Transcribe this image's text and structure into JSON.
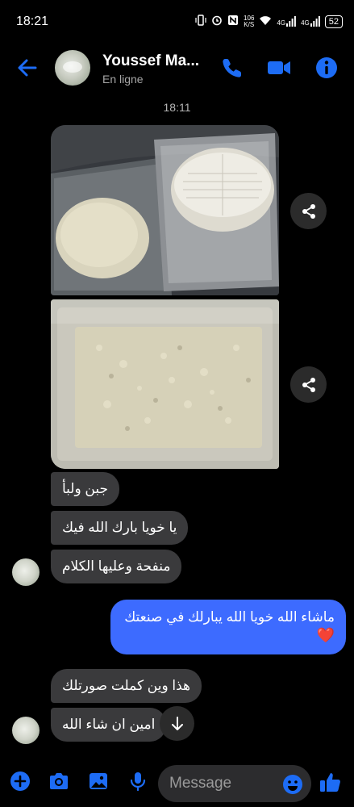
{
  "status_bar": {
    "time": "18:21",
    "net_speed_value": "106",
    "net_speed_unit": "K/S",
    "signal1_label": "4G",
    "signal2_label": "4G",
    "battery": "52"
  },
  "header": {
    "contact_name": "Youssef Ma...",
    "contact_status": "En ligne"
  },
  "conversation": {
    "timestamp": "18:11",
    "received_group_1": [
      "جبن ولبأ",
      "يا خويا بارك الله فيك",
      "منفحة وعليها الكلام"
    ],
    "sent_message": {
      "text": "ماشاء الله خويا الله يبارلك في صنعتك",
      "emoji": "❤️"
    },
    "received_group_2": [
      "هذا وين كملت صورتلك",
      "امين ان شاء الله"
    ]
  },
  "composer": {
    "placeholder": "Message"
  },
  "colors": {
    "accent": "#3d6bff",
    "icon_blue": "#1d6cf5",
    "received_bubble": "#3a3a3c",
    "background": "#000000"
  },
  "icons": [
    "back-arrow-icon",
    "phone-icon",
    "video-camera-icon",
    "info-icon",
    "share-icon",
    "arrow-down-icon",
    "plus-icon",
    "camera-icon",
    "image-icon",
    "microphone-icon",
    "emoji-icon",
    "thumbs-up-icon"
  ]
}
